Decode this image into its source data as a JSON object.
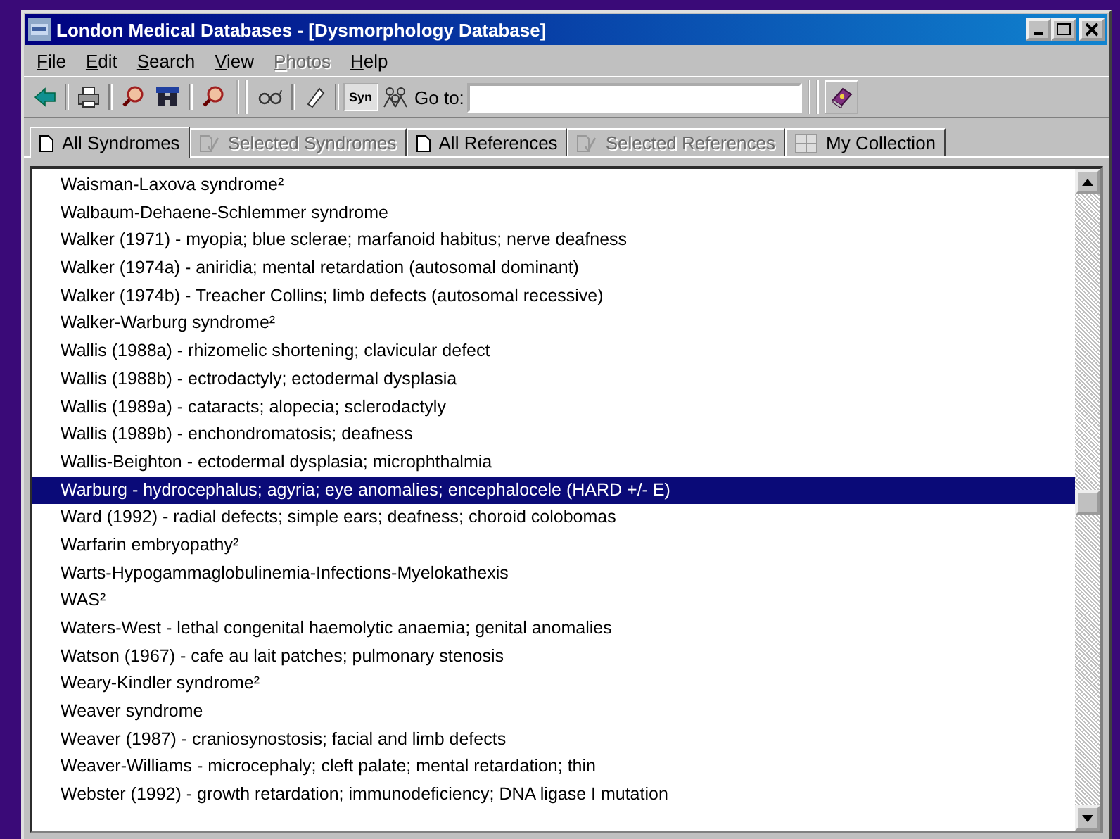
{
  "window": {
    "title": "London Medical Databases - [Dysmorphology Database]"
  },
  "menu": [
    {
      "label": "File",
      "disabled": false
    },
    {
      "label": "Edit",
      "disabled": false
    },
    {
      "label": "Search",
      "disabled": false
    },
    {
      "label": "View",
      "disabled": false
    },
    {
      "label": "Photos",
      "disabled": true
    },
    {
      "label": "Help",
      "disabled": false
    }
  ],
  "toolbar": {
    "syn_label": "Syn",
    "goto_label": "Go to:"
  },
  "tabs": [
    {
      "label": "All Syndromes",
      "selected": true,
      "disabled": false,
      "kind": "page"
    },
    {
      "label": "Selected Syndromes",
      "selected": false,
      "disabled": true,
      "kind": "select"
    },
    {
      "label": "All References",
      "selected": false,
      "disabled": false,
      "kind": "page"
    },
    {
      "label": "Selected References",
      "selected": false,
      "disabled": true,
      "kind": "select"
    },
    {
      "label": "My Collection",
      "selected": false,
      "disabled": false,
      "kind": "grid"
    }
  ],
  "list": [
    {
      "text": "Waisman-Laxova syndrome²",
      "selected": false
    },
    {
      "text": "Walbaum-Dehaene-Schlemmer syndrome",
      "selected": false
    },
    {
      "text": "Walker (1971) - myopia; blue sclerae; marfanoid habitus; nerve deafness",
      "selected": false
    },
    {
      "text": "Walker (1974a) - aniridia; mental retardation (autosomal dominant)",
      "selected": false
    },
    {
      "text": "Walker (1974b) - Treacher Collins; limb defects (autosomal recessive)",
      "selected": false
    },
    {
      "text": "Walker-Warburg syndrome²",
      "selected": false
    },
    {
      "text": "Wallis (1988a) - rhizomelic shortening; clavicular defect",
      "selected": false
    },
    {
      "text": "Wallis (1988b) - ectrodactyly; ectodermal dysplasia",
      "selected": false
    },
    {
      "text": "Wallis (1989a) - cataracts; alopecia; sclerodactyly",
      "selected": false
    },
    {
      "text": "Wallis (1989b) - enchondromatosis; deafness",
      "selected": false
    },
    {
      "text": "Wallis-Beighton - ectodermal dysplasia; microphthalmia",
      "selected": false
    },
    {
      "text": "Warburg - hydrocephalus; agyria; eye anomalies; encephalocele (HARD +/- E)",
      "selected": true
    },
    {
      "text": "Ward (1992) - radial defects; simple ears; deafness; choroid colobomas",
      "selected": false
    },
    {
      "text": "Warfarin embryopathy²",
      "selected": false
    },
    {
      "text": "Warts-Hypogammaglobulinemia-Infections-Myelokathexis",
      "selected": false
    },
    {
      "text": "WAS²",
      "selected": false
    },
    {
      "text": "Waters-West - lethal congenital haemolytic anaemia; genital anomalies",
      "selected": false
    },
    {
      "text": "Watson (1967) - cafe au lait patches; pulmonary stenosis",
      "selected": false
    },
    {
      "text": "Weary-Kindler syndrome²",
      "selected": false
    },
    {
      "text": "Weaver syndrome",
      "selected": false
    },
    {
      "text": "Weaver (1987) - craniosynostosis; facial and limb defects",
      "selected": false
    },
    {
      "text": "Weaver-Williams - microcephaly; cleft palate; mental retardation; thin",
      "selected": false
    },
    {
      "text": "Webster (1992) - growth retardation; immunodeficiency; DNA ligase I mutation",
      "selected": false
    }
  ]
}
